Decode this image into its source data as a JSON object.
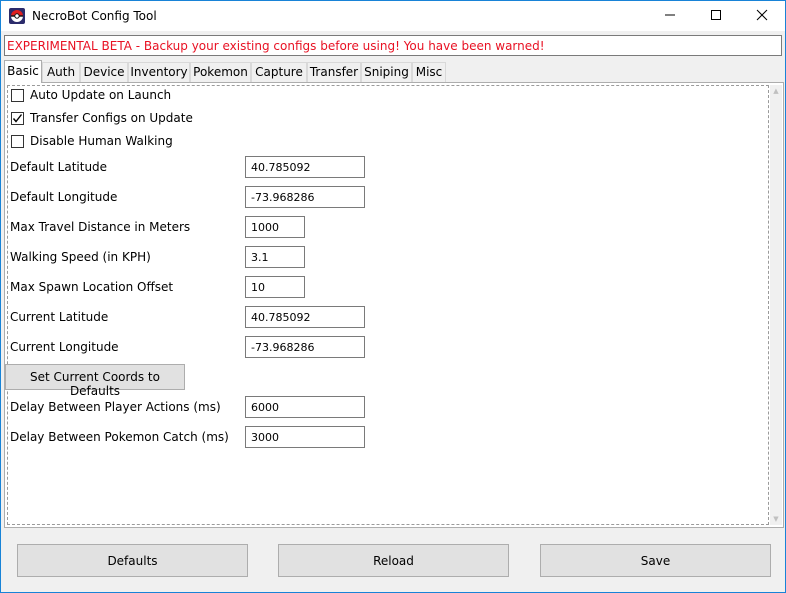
{
  "window": {
    "title": "NecroBot Config Tool",
    "icon": "pokeball-icon",
    "controls": [
      "minimize-icon",
      "maximize-icon",
      "close-icon"
    ]
  },
  "warning": {
    "text": "EXPERIMENTAL BETA - Backup your existing configs before using! You have been warned!",
    "color": "#e81123"
  },
  "tabs": [
    {
      "label": "Basic",
      "active": true
    },
    {
      "label": "Auth"
    },
    {
      "label": "Device"
    },
    {
      "label": "Inventory"
    },
    {
      "label": "Pokemon"
    },
    {
      "label": "Capture"
    },
    {
      "label": "Transfer"
    },
    {
      "label": "Sniping"
    },
    {
      "label": "Misc"
    }
  ],
  "basic": {
    "checkboxes": [
      {
        "label": "Auto Update on Launch",
        "checked": false
      },
      {
        "label": "Transfer Configs on Update",
        "checked": true
      },
      {
        "label": "Disable Human Walking",
        "checked": false
      }
    ],
    "fields": [
      {
        "label": "Default Latitude",
        "value": "40.785092"
      },
      {
        "label": "Default Longitude",
        "value": "-73.968286"
      },
      {
        "label": "Max Travel Distance in Meters",
        "value": "1000"
      },
      {
        "label": "Walking Speed (in KPH)",
        "value": "3.1"
      },
      {
        "label": "Max Spawn Location Offset",
        "value": "10"
      },
      {
        "label": "Current Latitude",
        "value": "40.785092"
      },
      {
        "label": "Current Longitude",
        "value": "-73.968286"
      },
      {
        "label": "Delay Between Player Actions (ms)",
        "value": "6000"
      },
      {
        "label": "Delay Between Pokemon Catch (ms)",
        "value": "3000"
      }
    ],
    "set_coords_button": "Set Current Coords to Defaults"
  },
  "footer": {
    "defaults": "Defaults",
    "reload": "Reload",
    "save": "Save"
  }
}
